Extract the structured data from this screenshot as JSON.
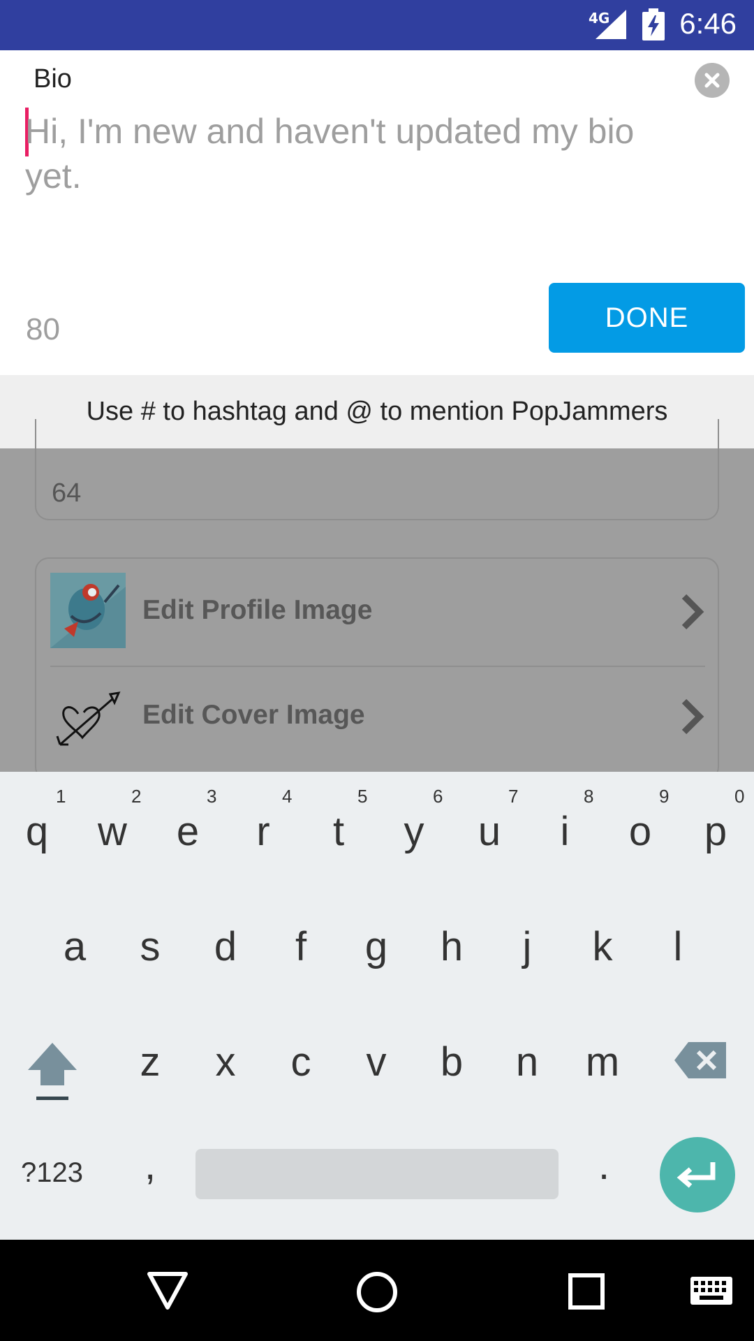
{
  "status_bar": {
    "time": "6:46",
    "network": "4G"
  },
  "bio_editor": {
    "label": "Bio",
    "placeholder": "Hi, I'm new and haven't updated my bio yet.",
    "char_count": "80",
    "done_label": "DONE"
  },
  "hint_bar": {
    "text": "Use # to hashtag and @ to mention PopJammers"
  },
  "background": {
    "count_value": "64",
    "rows": [
      {
        "label": "Edit Profile Image"
      },
      {
        "label": "Edit Cover Image"
      }
    ]
  },
  "keyboard": {
    "row1": [
      "q",
      "w",
      "e",
      "r",
      "t",
      "y",
      "u",
      "i",
      "o",
      "p"
    ],
    "row1_hints": [
      "1",
      "2",
      "3",
      "4",
      "5",
      "6",
      "7",
      "8",
      "9",
      "0"
    ],
    "row2": [
      "a",
      "s",
      "d",
      "f",
      "g",
      "h",
      "j",
      "k",
      "l"
    ],
    "row3": [
      "z",
      "x",
      "c",
      "v",
      "b",
      "n",
      "m"
    ],
    "symbols_label": "?123",
    "comma": ",",
    "period": "."
  },
  "colors": {
    "status_bar": "#303f9f",
    "done_button": "#039be5",
    "caret": "#e91e63",
    "enter_key": "#4db6ac"
  }
}
